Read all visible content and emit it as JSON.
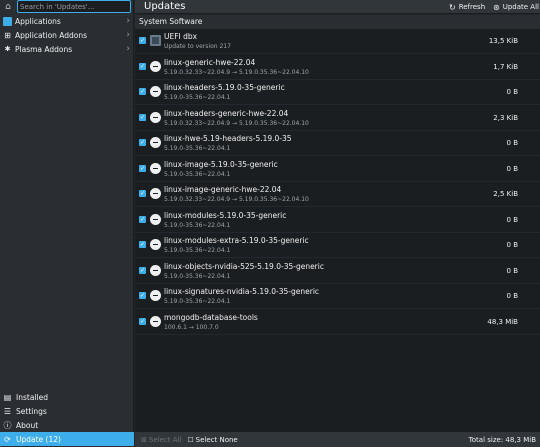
{
  "search": {
    "placeholder": "Search in 'Updates'..."
  },
  "sidebar": {
    "categories": [
      {
        "label": "Applications",
        "icon": "applications-icon"
      },
      {
        "label": "Application Addons",
        "icon": "addons-icon"
      },
      {
        "label": "Plasma Addons",
        "icon": "plasma-icon"
      }
    ],
    "bottom": [
      {
        "label": "Installed",
        "icon": "installed-icon"
      },
      {
        "label": "Settings",
        "icon": "settings-icon"
      },
      {
        "label": "About",
        "icon": "about-icon"
      },
      {
        "label": "Update (12)",
        "icon": "update-icon"
      }
    ]
  },
  "header": {
    "title": "Updates",
    "refresh_label": "Refresh",
    "update_all_label": "Update All"
  },
  "list": {
    "section_title": "System Software",
    "rows": [
      {
        "name": "UEFI dbx",
        "version": "Update to version 217",
        "size": "13,5 KiB",
        "checked": true,
        "icon": "firmware-chip-icon"
      },
      {
        "name": "linux-generic-hwe-22.04",
        "version": "5.19.0.32.33~22.04.9 → 5.19.0.35.36~22.04.10",
        "size": "1,7 KiB",
        "checked": true,
        "icon": "package-icon"
      },
      {
        "name": "linux-headers-5.19.0-35-generic",
        "version": "5.19.0-35.36~22.04.1",
        "size": "0 B",
        "checked": true,
        "icon": "package-icon"
      },
      {
        "name": "linux-headers-generic-hwe-22.04",
        "version": "5.19.0.32.33~22.04.9 → 5.19.0.35.36~22.04.10",
        "size": "2,3 KiB",
        "checked": true,
        "icon": "package-icon"
      },
      {
        "name": "linux-hwe-5.19-headers-5.19.0-35",
        "version": "5.19.0-35.36~22.04.1",
        "size": "0 B",
        "checked": true,
        "icon": "package-icon"
      },
      {
        "name": "linux-image-5.19.0-35-generic",
        "version": "5.19.0-35.36~22.04.1",
        "size": "0 B",
        "checked": true,
        "icon": "package-icon"
      },
      {
        "name": "linux-image-generic-hwe-22.04",
        "version": "5.19.0.32.33~22.04.9 → 5.19.0.35.36~22.04.10",
        "size": "2,5 KiB",
        "checked": true,
        "icon": "package-icon"
      },
      {
        "name": "linux-modules-5.19.0-35-generic",
        "version": "5.19.0-35.36~22.04.1",
        "size": "0 B",
        "checked": true,
        "icon": "package-icon"
      },
      {
        "name": "linux-modules-extra-5.19.0-35-generic",
        "version": "5.19.0-35.36~22.04.1",
        "size": "0 B",
        "checked": true,
        "icon": "package-icon"
      },
      {
        "name": "linux-objects-nvidia-525-5.19.0-35-generic",
        "version": "5.19.0-35.36~22.04.1",
        "size": "0 B",
        "checked": true,
        "icon": "package-icon"
      },
      {
        "name": "linux-signatures-nvidia-5.19.0-35-generic",
        "version": "5.19.0-35.36~22.04.1",
        "size": "0 B",
        "checked": true,
        "icon": "package-icon"
      },
      {
        "name": "mongodb-database-tools",
        "version": "100.6.1 → 100.7.0",
        "size": "48,3 MiB",
        "checked": true,
        "icon": "package-icon"
      }
    ]
  },
  "footer": {
    "select_all_label": "Select All",
    "select_none_label": "Select None",
    "total_size": "Total size: 48,3 MiB"
  },
  "colors": {
    "accent": "#3daee9",
    "background": "#232629",
    "list_background": "#1b1e20"
  }
}
